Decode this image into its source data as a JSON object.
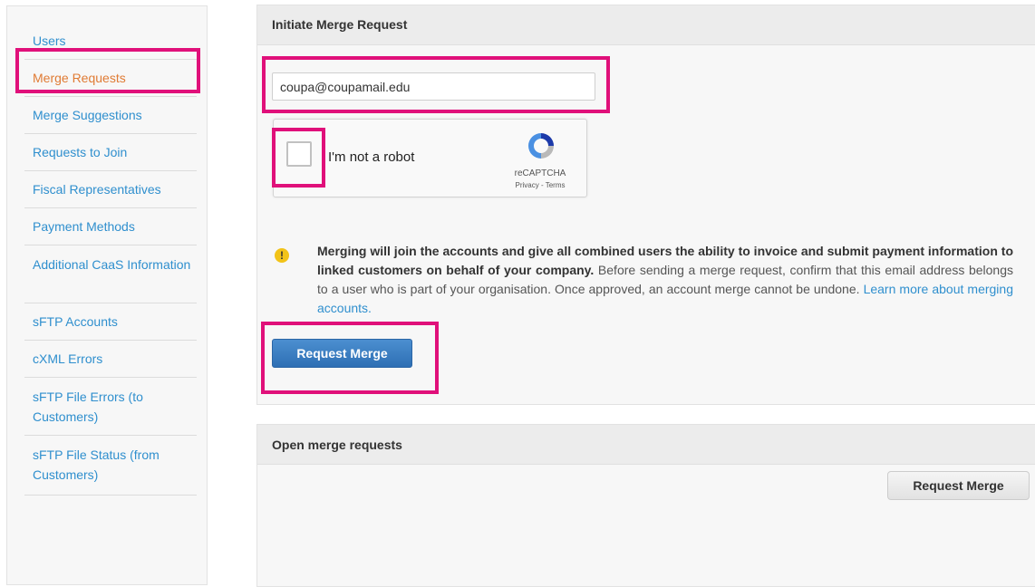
{
  "sidebar": {
    "items": [
      {
        "label": "Users"
      },
      {
        "label": "Merge Requests"
      },
      {
        "label": "Merge Suggestions"
      },
      {
        "label": "Requests to Join"
      },
      {
        "label": "Fiscal Representatives"
      },
      {
        "label": "Payment Methods"
      },
      {
        "label": "Additional CaaS Information"
      },
      {
        "label": "sFTP Accounts"
      },
      {
        "label": "cXML Errors"
      },
      {
        "label": "sFTP File Errors (to Customers)"
      },
      {
        "label": "sFTP File Status (from Customers)"
      }
    ],
    "active_index": 1
  },
  "merge_panel": {
    "title": "Initiate Merge Request",
    "email_value": "coupa@coupamail.edu",
    "captcha": {
      "label": "I'm not a robot",
      "brand": "reCAPTCHA",
      "links": "Privacy - Terms"
    },
    "notice": {
      "bold": "Merging will join the accounts and give all combined users the ability to invoice and submit payment information to linked customers on behalf of your company.",
      "body": " Before sending a merge request, confirm that this email address belongs to a user who is part of your organisation. Once approved, an account merge cannot be undone. ",
      "link": "Learn more about merging accounts."
    },
    "button_label": "Request Merge"
  },
  "open_panel": {
    "title": "Open merge requests",
    "button_label": "Request Merge"
  },
  "colors": {
    "link": "#2f8fce",
    "active": "#e07b34",
    "highlight": "#e0107a",
    "primary_button": "#3a7dc2"
  },
  "icons": [
    "warning-icon",
    "recaptcha-logo-icon"
  ]
}
